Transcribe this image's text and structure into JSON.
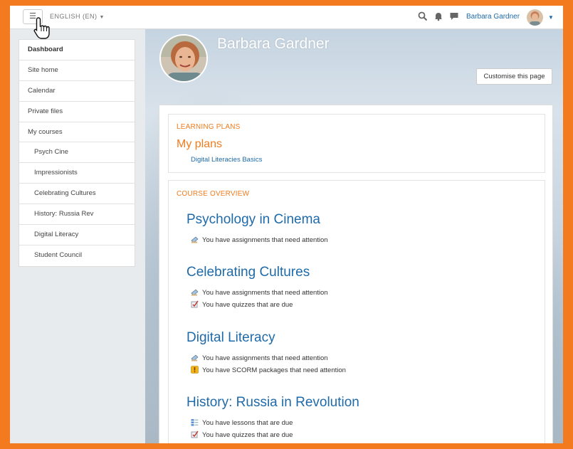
{
  "navbar": {
    "menu_icon": "hamburger-icon",
    "language": "ENGLISH (EN)",
    "icons": [
      "search-icon",
      "notifications-icon",
      "messages-icon"
    ],
    "user_name": "Barbara Gardner"
  },
  "sidebar": {
    "items": [
      {
        "label": "Dashboard"
      },
      {
        "label": "Site home"
      },
      {
        "label": "Calendar"
      },
      {
        "label": "Private files"
      },
      {
        "label": "My courses"
      },
      {
        "label": "Psych Cine"
      },
      {
        "label": "Impressionists"
      },
      {
        "label": "Celebrating Cultures"
      },
      {
        "label": "History: Russia Rev"
      },
      {
        "label": "Digital Literacy"
      },
      {
        "label": "Student Council"
      }
    ]
  },
  "header": {
    "name": "Barbara Gardner",
    "customise_label": "Customise this page"
  },
  "learning_plans": {
    "title": "LEARNING PLANS",
    "subtitle": "My plans",
    "plans": [
      "Digital Literacies Basics"
    ]
  },
  "course_overview": {
    "title": "COURSE OVERVIEW",
    "courses": [
      {
        "name": "Psychology in Cinema",
        "lines": [
          {
            "icon": "assignment-icon",
            "text": "You have assignments that need attention"
          }
        ]
      },
      {
        "name": "Celebrating Cultures",
        "lines": [
          {
            "icon": "assignment-icon",
            "text": "You have assignments that need attention"
          },
          {
            "icon": "quiz-icon",
            "text": "You have quizzes that are due"
          }
        ]
      },
      {
        "name": "Digital Literacy",
        "lines": [
          {
            "icon": "assignment-icon",
            "text": "You have assignments that need attention"
          },
          {
            "icon": "scorm-icon",
            "text": "You have SCORM packages that need attention"
          }
        ]
      },
      {
        "name": "History: Russia in Revolution",
        "lines": [
          {
            "icon": "lesson-icon",
            "text": "You have lessons that are due"
          },
          {
            "icon": "quiz-icon",
            "text": "You have quizzes that are due"
          }
        ]
      }
    ]
  }
}
